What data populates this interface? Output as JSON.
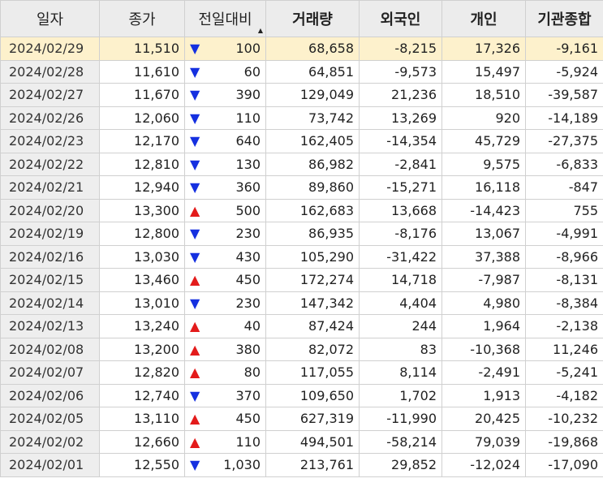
{
  "headers": {
    "date": "일자",
    "close": "종가",
    "change": "전일대비",
    "volume": "거래량",
    "foreign": "외국인",
    "individual": "개인",
    "institution": "기관종합"
  },
  "sort_indicator": "▲",
  "colors": {
    "up": "#d52b2b",
    "down": "#1f2d9b",
    "selected_row": "#fdf1cc"
  },
  "rows": [
    {
      "date": "2024/02/29",
      "close": "11,510",
      "dir": "down",
      "change": "100",
      "volume": "68,658",
      "foreign": "-8,215",
      "individual": "17,326",
      "institution": "-9,161"
    },
    {
      "date": "2024/02/28",
      "close": "11,610",
      "dir": "down",
      "change": "60",
      "volume": "64,851",
      "foreign": "-9,573",
      "individual": "15,497",
      "institution": "-5,924"
    },
    {
      "date": "2024/02/27",
      "close": "11,670",
      "dir": "down",
      "change": "390",
      "volume": "129,049",
      "foreign": "21,236",
      "individual": "18,510",
      "institution": "-39,587"
    },
    {
      "date": "2024/02/26",
      "close": "12,060",
      "dir": "down",
      "change": "110",
      "volume": "73,742",
      "foreign": "13,269",
      "individual": "920",
      "institution": "-14,189"
    },
    {
      "date": "2024/02/23",
      "close": "12,170",
      "dir": "down",
      "change": "640",
      "volume": "162,405",
      "foreign": "-14,354",
      "individual": "45,729",
      "institution": "-27,375"
    },
    {
      "date": "2024/02/22",
      "close": "12,810",
      "dir": "down",
      "change": "130",
      "volume": "86,982",
      "foreign": "-2,841",
      "individual": "9,575",
      "institution": "-6,833"
    },
    {
      "date": "2024/02/21",
      "close": "12,940",
      "dir": "down",
      "change": "360",
      "volume": "89,860",
      "foreign": "-15,271",
      "individual": "16,118",
      "institution": "-847"
    },
    {
      "date": "2024/02/20",
      "close": "13,300",
      "dir": "up",
      "change": "500",
      "volume": "162,683",
      "foreign": "13,668",
      "individual": "-14,423",
      "institution": "755"
    },
    {
      "date": "2024/02/19",
      "close": "12,800",
      "dir": "down",
      "change": "230",
      "volume": "86,935",
      "foreign": "-8,176",
      "individual": "13,067",
      "institution": "-4,991"
    },
    {
      "date": "2024/02/16",
      "close": "13,030",
      "dir": "down",
      "change": "430",
      "volume": "105,290",
      "foreign": "-31,422",
      "individual": "37,388",
      "institution": "-8,966"
    },
    {
      "date": "2024/02/15",
      "close": "13,460",
      "dir": "up",
      "change": "450",
      "volume": "172,274",
      "foreign": "14,718",
      "individual": "-7,987",
      "institution": "-8,131"
    },
    {
      "date": "2024/02/14",
      "close": "13,010",
      "dir": "down",
      "change": "230",
      "volume": "147,342",
      "foreign": "4,404",
      "individual": "4,980",
      "institution": "-8,384"
    },
    {
      "date": "2024/02/13",
      "close": "13,240",
      "dir": "up",
      "change": "40",
      "volume": "87,424",
      "foreign": "244",
      "individual": "1,964",
      "institution": "-2,138"
    },
    {
      "date": "2024/02/08",
      "close": "13,200",
      "dir": "up",
      "change": "380",
      "volume": "82,072",
      "foreign": "83",
      "individual": "-10,368",
      "institution": "11,246"
    },
    {
      "date": "2024/02/07",
      "close": "12,820",
      "dir": "up",
      "change": "80",
      "volume": "117,055",
      "foreign": "8,114",
      "individual": "-2,491",
      "institution": "-5,241"
    },
    {
      "date": "2024/02/06",
      "close": "12,740",
      "dir": "down",
      "change": "370",
      "volume": "109,650",
      "foreign": "1,702",
      "individual": "1,913",
      "institution": "-4,182"
    },
    {
      "date": "2024/02/05",
      "close": "13,110",
      "dir": "up",
      "change": "450",
      "volume": "627,319",
      "foreign": "-11,990",
      "individual": "20,425",
      "institution": "-10,232"
    },
    {
      "date": "2024/02/02",
      "close": "12,660",
      "dir": "up",
      "change": "110",
      "volume": "494,501",
      "foreign": "-58,214",
      "individual": "79,039",
      "institution": "-19,868"
    },
    {
      "date": "2024/02/01",
      "close": "12,550",
      "dir": "down",
      "change": "1,030",
      "volume": "213,761",
      "foreign": "29,852",
      "individual": "-12,024",
      "institution": "-17,090"
    }
  ]
}
